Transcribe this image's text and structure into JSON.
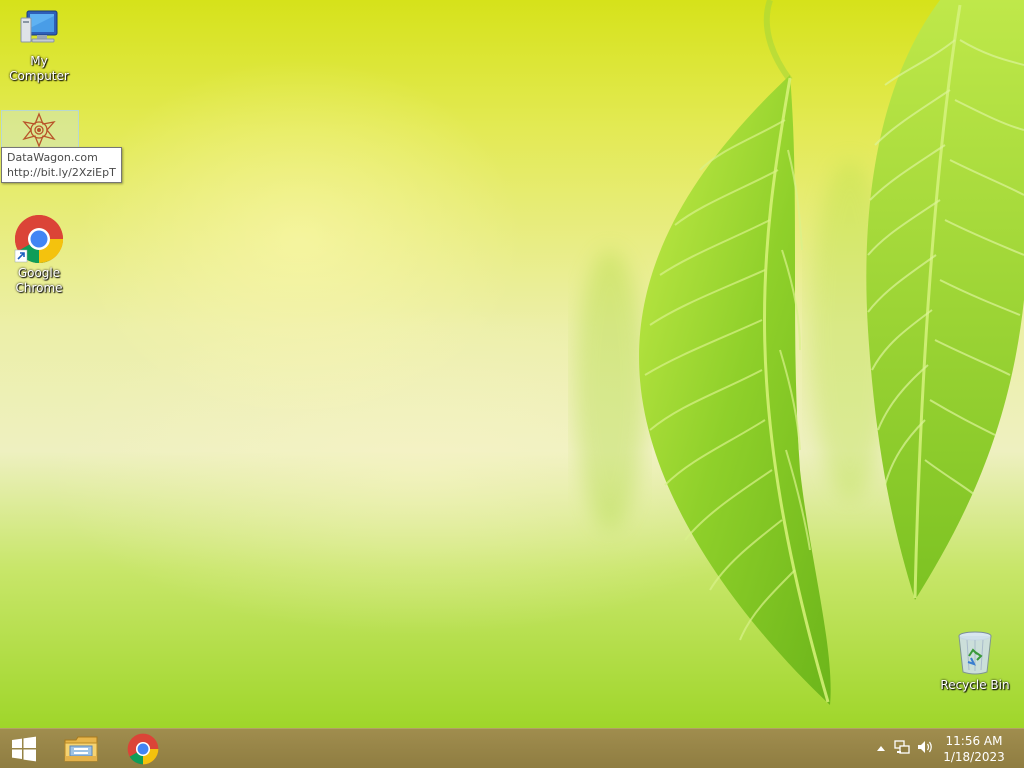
{
  "desktop": {
    "icons": [
      {
        "name": "my-computer",
        "label": "My Computer"
      },
      {
        "name": "datawagon",
        "label": ""
      },
      {
        "name": "google-chrome",
        "label": "Google Chrome"
      },
      {
        "name": "recycle-bin",
        "label": "Recycle Bin"
      }
    ],
    "tooltip": {
      "line1": "DataWagon.com",
      "line2": "http://bit.ly/2XziEpT"
    }
  },
  "taskbar": {
    "pinned": [
      "start",
      "file-explorer",
      "google-chrome"
    ],
    "tray_icons": [
      "show-hidden-icons",
      "network-icon",
      "volume-icon"
    ],
    "clock": {
      "time": "11:56 AM",
      "date": "1/18/2023"
    }
  }
}
